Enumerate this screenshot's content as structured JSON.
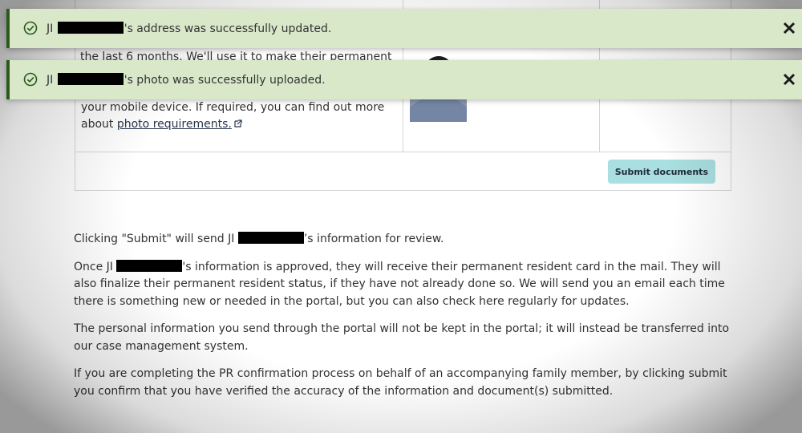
{
  "table": {
    "top_partial_text": "the last 6 months. We'll use it to make their permanent",
    "row_text_line1": "your mobile device. If required, you can find out more",
    "row_text_prefix": "about",
    "photo_link": "photo requirements.",
    "submit_documents_label": "Submit documents"
  },
  "alerts": [
    {
      "prefix": "JI",
      "suffix": "'s address was successfully updated."
    },
    {
      "prefix": "JI",
      "suffix": "'s photo was successfully uploaded."
    }
  ],
  "content": {
    "p1_prefix": "Clicking \"Submit\" will send JI",
    "p1_suffix": "’s information for review.",
    "p2_prefix": "Once JI",
    "p2_suffix": "'s information is approved, they will receive their permanent resident card in the mail. They will also finalize their permanent resident status, if they have not already done so. We will send you an email each time there is something new or needed in the portal, but you can also check here regularly for updates.",
    "p3": "The personal information you send through the portal will not be kept in the portal; it will instead be transferred into our case management system.",
    "p4": "If you are completing the PR confirmation process on behalf of an accompanying family member, by clicking submit you confirm that you have verified the accuracy of the information and document(s) submitted."
  },
  "colors": {
    "alert_bg": "#d8e8c9",
    "alert_border": "#2b5a1d",
    "button_bg": "#a9dfe0",
    "link": "#26374a"
  }
}
